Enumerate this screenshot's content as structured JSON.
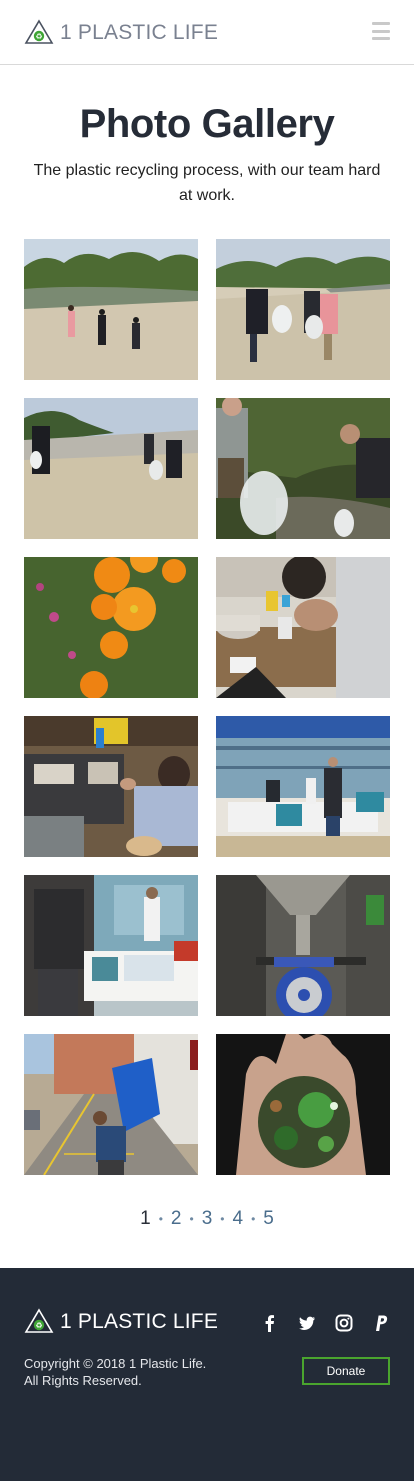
{
  "header": {
    "brand": "1 PLASTIC LIFE",
    "menu_icon": "hamburger-icon",
    "logo_icon": "recycle-triangle-icon"
  },
  "hero": {
    "title": "Photo Gallery",
    "subtitle": "The plastic recycling process, with our team hard at work."
  },
  "gallery": {
    "photos": [
      "river-cleanup-group-walking",
      "river-cleanup-volunteers-bags",
      "riverbed-cleanup-walkers",
      "creek-cleanup-collecting",
      "orange-poppies-flowers",
      "lab-inspecting-plastic",
      "workbench-electronics",
      "outdoor-event-booth",
      "booth-visitors-banner",
      "shredder-machine-hopper",
      "carrying-blue-cups-alley",
      "recycled-plastic-disc-hand"
    ]
  },
  "pagination": {
    "pages": [
      "1",
      "2",
      "3",
      "4",
      "5"
    ],
    "current": "1",
    "separator": "•"
  },
  "footer": {
    "brand": "1 PLASTIC LIFE",
    "copyright_line1": "Copyright © 2018 1 Plastic Life.",
    "copyright_line2": "All Rights Reserved.",
    "donate_label": "Donate",
    "socials": [
      "facebook-icon",
      "twitter-icon",
      "instagram-icon",
      "paypal-icon"
    ]
  },
  "colors": {
    "footer_bg": "#232b37",
    "accent_green": "#4aa52e",
    "title": "#262c37",
    "pager": "#4a6d8c"
  }
}
